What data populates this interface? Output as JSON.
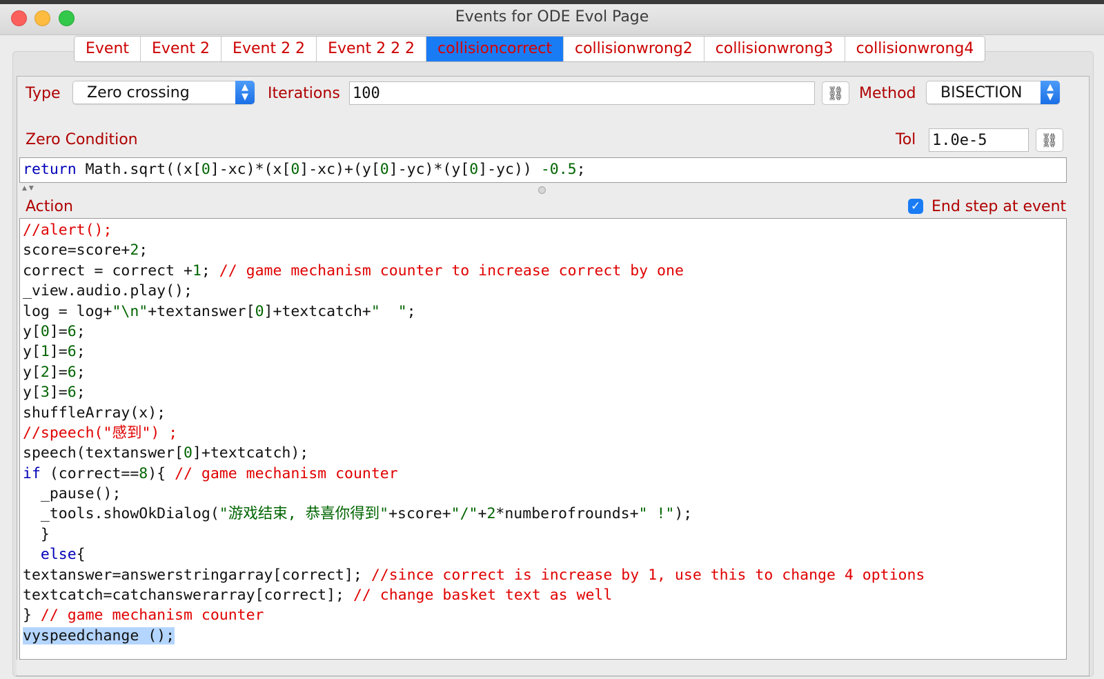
{
  "window": {
    "title": "Events for ODE Evol Page"
  },
  "tabs": [
    {
      "label": "Event",
      "active": false
    },
    {
      "label": "Event 2",
      "active": false
    },
    {
      "label": "Event 2 2",
      "active": false
    },
    {
      "label": "Event 2 2 2",
      "active": false
    },
    {
      "label": "collisioncorrect",
      "active": true
    },
    {
      "label": "collisionwrong2",
      "active": false
    },
    {
      "label": "collisionwrong3",
      "active": false
    },
    {
      "label": "collisionwrong4",
      "active": false
    }
  ],
  "type": {
    "label": "Type",
    "value": "Zero crossing"
  },
  "iterations": {
    "label": "Iterations",
    "value": "100"
  },
  "method": {
    "label": "Method",
    "value": "BISECTION"
  },
  "zero_condition": {
    "label": "Zero Condition",
    "tol_label": "Tol",
    "tol_value": "1.0e-5"
  },
  "zero_code": {
    "kw": "return",
    "t1": " Math.sqrt((x[",
    "n1": "0",
    "t2": "]-xc)*(x[",
    "n2": "0",
    "t3": "]-xc)+(y[",
    "n3": "0",
    "t4": "]-yc)*(y[",
    "n4": "0",
    "t5": "]-yc)) ",
    "n5": "-0.5",
    "t6": ";"
  },
  "action": {
    "label": "Action",
    "end_step_label": "End step at event",
    "end_step_checked": true,
    "lines": [
      [
        {
          "c": "cmt",
          "t": "//alert();"
        }
      ],
      [
        {
          "c": "",
          "t": "score=score+"
        },
        {
          "c": "num",
          "t": "2"
        },
        {
          "c": "",
          "t": ";"
        }
      ],
      [
        {
          "c": "",
          "t": "correct = correct +"
        },
        {
          "c": "num",
          "t": "1"
        },
        {
          "c": "",
          "t": "; "
        },
        {
          "c": "cmt",
          "t": "// game mechanism counter to increase correct by one"
        }
      ],
      [
        {
          "c": "",
          "t": "_view.audio.play();"
        }
      ],
      [
        {
          "c": "",
          "t": "log = log+"
        },
        {
          "c": "str",
          "t": "\"\\n\""
        },
        {
          "c": "",
          "t": "+textanswer["
        },
        {
          "c": "num",
          "t": "0"
        },
        {
          "c": "",
          "t": "]+textcatch+"
        },
        {
          "c": "str",
          "t": "\"  \""
        },
        {
          "c": "",
          "t": ";"
        }
      ],
      [
        {
          "c": "",
          "t": "y["
        },
        {
          "c": "num",
          "t": "0"
        },
        {
          "c": "",
          "t": "]="
        },
        {
          "c": "num",
          "t": "6"
        },
        {
          "c": "",
          "t": ";"
        }
      ],
      [
        {
          "c": "",
          "t": "y["
        },
        {
          "c": "num",
          "t": "1"
        },
        {
          "c": "",
          "t": "]="
        },
        {
          "c": "num",
          "t": "6"
        },
        {
          "c": "",
          "t": ";"
        }
      ],
      [
        {
          "c": "",
          "t": "y["
        },
        {
          "c": "num",
          "t": "2"
        },
        {
          "c": "",
          "t": "]="
        },
        {
          "c": "num",
          "t": "6"
        },
        {
          "c": "",
          "t": ";"
        }
      ],
      [
        {
          "c": "",
          "t": "y["
        },
        {
          "c": "num",
          "t": "3"
        },
        {
          "c": "",
          "t": "]="
        },
        {
          "c": "num",
          "t": "6"
        },
        {
          "c": "",
          "t": ";"
        }
      ],
      [
        {
          "c": "",
          "t": "shuffleArray(x);"
        }
      ],
      [
        {
          "c": "cmt",
          "t": "//speech(\"感到\") ;"
        }
      ],
      [
        {
          "c": "",
          "t": "speech(textanswer["
        },
        {
          "c": "num",
          "t": "0"
        },
        {
          "c": "",
          "t": "]+textcatch);"
        }
      ],
      [
        {
          "c": "kw",
          "t": "if"
        },
        {
          "c": "",
          "t": " (correct=="
        },
        {
          "c": "num",
          "t": "8"
        },
        {
          "c": "",
          "t": "){ "
        },
        {
          "c": "cmt",
          "t": "// game mechanism counter"
        }
      ],
      [
        {
          "c": "",
          "t": "  _pause();"
        }
      ],
      [
        {
          "c": "",
          "t": "  _tools.showOkDialog("
        },
        {
          "c": "str",
          "t": "\"游戏结束, 恭喜你得到\""
        },
        {
          "c": "",
          "t": "+score+"
        },
        {
          "c": "str",
          "t": "\"/\""
        },
        {
          "c": "",
          "t": "+"
        },
        {
          "c": "num",
          "t": "2"
        },
        {
          "c": "",
          "t": "*numberofrounds+"
        },
        {
          "c": "str",
          "t": "\" !\""
        },
        {
          "c": "",
          "t": ");"
        }
      ],
      [
        {
          "c": "",
          "t": "  }"
        }
      ],
      [
        {
          "c": "kw",
          "t": "  else"
        },
        {
          "c": "",
          "t": "{"
        }
      ],
      [
        {
          "c": "",
          "t": "textanswer=answerstringarray[correct]; "
        },
        {
          "c": "cmt",
          "t": "//since correct is increase by 1, use this to change 4 options"
        }
      ],
      [
        {
          "c": "",
          "t": "textcatch=catchanswerarray[correct]; "
        },
        {
          "c": "cmt",
          "t": "// change basket text as well"
        }
      ],
      [
        {
          "c": "",
          "t": "} "
        },
        {
          "c": "cmt",
          "t": "// game mechanism counter"
        }
      ],
      [
        {
          "c": "sel",
          "t": "vyspeedchange ();"
        }
      ]
    ]
  }
}
